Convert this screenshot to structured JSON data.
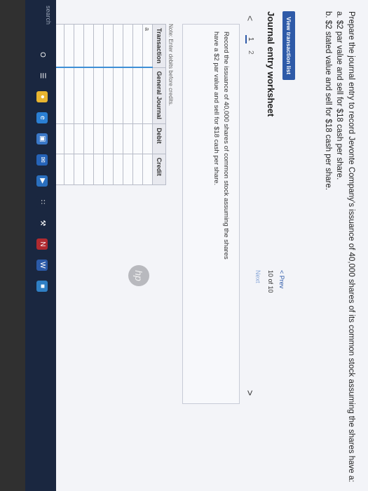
{
  "question": {
    "lines": [
      "Prepare the journal entry to record Jevonte Company's issuance of 40,000 shares of its common stock assuming the shares have a:",
      "a. $2 par value and sell for $18 cash per share.",
      "b. $2 stated value and sell for $18 cash per share."
    ]
  },
  "view_button": "View transaction list",
  "worksheet": {
    "title": "Journal entry worksheet",
    "nav_prev": "<",
    "page1": "1",
    "page2": "2",
    "nav_next": ">",
    "instruction": "Record the issuance of 40,000 shares of common stock assuming the shares have a $2 par value and sell for $18 cash per share.",
    "note": "Note: Enter debits before credits.",
    "columns": [
      "Transaction",
      "General Journal",
      "Debit",
      "Credit"
    ],
    "rows": [
      [
        "a",
        "",
        "",
        ""
      ],
      [
        "",
        "",
        "",
        ""
      ],
      [
        "",
        "",
        "",
        ""
      ],
      [
        "",
        "",
        "",
        ""
      ],
      [
        "",
        "",
        "",
        ""
      ],
      [
        "",
        "",
        "",
        ""
      ],
      [
        "",
        "",
        "",
        ""
      ],
      [
        "",
        "",
        "",
        ""
      ],
      [
        "",
        "",
        "",
        ""
      ],
      [
        "",
        "",
        "",
        ""
      ],
      [
        "",
        "",
        "",
        ""
      ],
      [
        "",
        "",
        "",
        ""
      ],
      [
        "",
        "",
        "",
        ""
      ],
      [
        "",
        "",
        "",
        ""
      ],
      [
        "",
        "",
        "",
        ""
      ],
      [
        "",
        "",
        "",
        ""
      ],
      [
        "",
        "",
        "",
        ""
      ],
      [
        "",
        "",
        "",
        ""
      ],
      [
        "",
        "",
        "",
        ""
      ],
      [
        "",
        "",
        "",
        ""
      ]
    ]
  },
  "pager": {
    "prev": "< Prev",
    "count": "10 of 10",
    "next": "Next"
  },
  "logo": "hp",
  "taskbar": {
    "search": "search",
    "icons": [
      {
        "name": "cortana-icon",
        "glyph": "O",
        "color": "#1a2740"
      },
      {
        "name": "task-view-icon",
        "glyph": "☰",
        "color": "#1a2740"
      },
      {
        "name": "chrome-icon",
        "glyph": "●",
        "color": "#e8b530"
      },
      {
        "name": "edge-icon",
        "glyph": "e",
        "color": "#2a7fd4"
      },
      {
        "name": "store-icon",
        "glyph": "▣",
        "color": "#3a78c8"
      },
      {
        "name": "mail-icon",
        "glyph": "✉",
        "color": "#2563b8"
      },
      {
        "name": "media-icon",
        "glyph": "▶",
        "color": "#2a6fbf"
      },
      {
        "name": "apps-icon",
        "glyph": "∷",
        "color": "#1a2740"
      },
      {
        "name": "tool-icon",
        "glyph": "⚒",
        "color": "#1a2740"
      },
      {
        "name": "onenote-icon",
        "glyph": "N",
        "color": "#b02a30"
      },
      {
        "name": "word-icon",
        "glyph": "W",
        "color": "#2b5aa8"
      },
      {
        "name": "folder-icon",
        "glyph": "■",
        "color": "#2f7fc4"
      }
    ]
  }
}
